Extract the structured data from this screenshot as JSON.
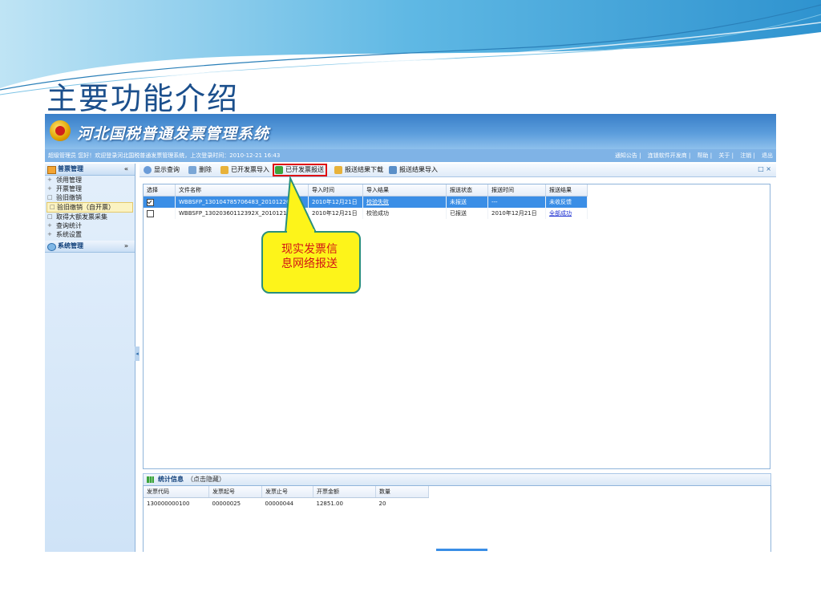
{
  "slide": {
    "title": "主要功能介绍"
  },
  "app": {
    "title": "河北国税普通发票管理系统",
    "welcome": "超级管理员 您好！欢迎登录河北国税普通发票管理系统，上次登录时间：2010-12-21 16:43",
    "top_links": [
      "通知公告",
      "连锁软件开发商",
      "帮助",
      "关于",
      "注销",
      "退出"
    ],
    "sidebar": {
      "header": "普票管理",
      "items": [
        {
          "label": "领用管理",
          "prefix": "+"
        },
        {
          "label": "开票管理",
          "prefix": "+"
        },
        {
          "label": "验旧缴销",
          "prefix": "□"
        },
        {
          "label": "验旧缴销（自开票）",
          "prefix": "□",
          "selected": true
        },
        {
          "label": "取得大额发票采集",
          "prefix": "□"
        },
        {
          "label": "查询统计",
          "prefix": "+"
        },
        {
          "label": "系统设置",
          "prefix": "+"
        }
      ],
      "header2": "系统管理"
    },
    "toolbar": {
      "buttons": [
        {
          "label": "显示查询",
          "icon": "magnifier-icon",
          "color": "#6a9bd8"
        },
        {
          "label": "删除",
          "icon": "trash-icon",
          "color": "#7aa6d6"
        },
        {
          "label": "已开发票导入",
          "icon": "import-icon",
          "color": "#e8b23a"
        },
        {
          "label": "已开发票报送",
          "icon": "report-send-icon",
          "color": "#3ca43c",
          "highlighted": true
        },
        {
          "label": "报送结果下载",
          "icon": "download-icon",
          "color": "#e8b23a"
        },
        {
          "label": "报送结果导入",
          "icon": "result-import-icon",
          "color": "#5a8fc8"
        }
      ]
    },
    "grid": {
      "columns": [
        "选择",
        "文件名称",
        "导入时间",
        "导入结果",
        "报送状态",
        "报送时间",
        "报送结果"
      ],
      "rows": [
        {
          "checked": true,
          "selected": true,
          "cells": [
            "WBBSFP_130104785706483_20101220",
            "2010年12月21日",
            "校验失败",
            "未报送",
            "---",
            "未收反馈"
          ]
        },
        {
          "checked": false,
          "selected": false,
          "cells": [
            "WBBSFP_13020360112392X_20101219_1",
            "2010年12月21日",
            "校验成功",
            "已报送",
            "2010年12月21日",
            "全部成功"
          ]
        }
      ]
    },
    "callout": {
      "line1": "现实发票信",
      "line2": "息网络报送"
    },
    "stats": {
      "title": "统计信息",
      "hint": "（点击隐藏）",
      "columns": [
        "发票代码",
        "发票起号",
        "发票止号",
        "开票金额",
        "数量"
      ],
      "rows": [
        [
          "130000000100",
          "00000025",
          "00000044",
          "12851.00",
          "20"
        ]
      ]
    }
  }
}
